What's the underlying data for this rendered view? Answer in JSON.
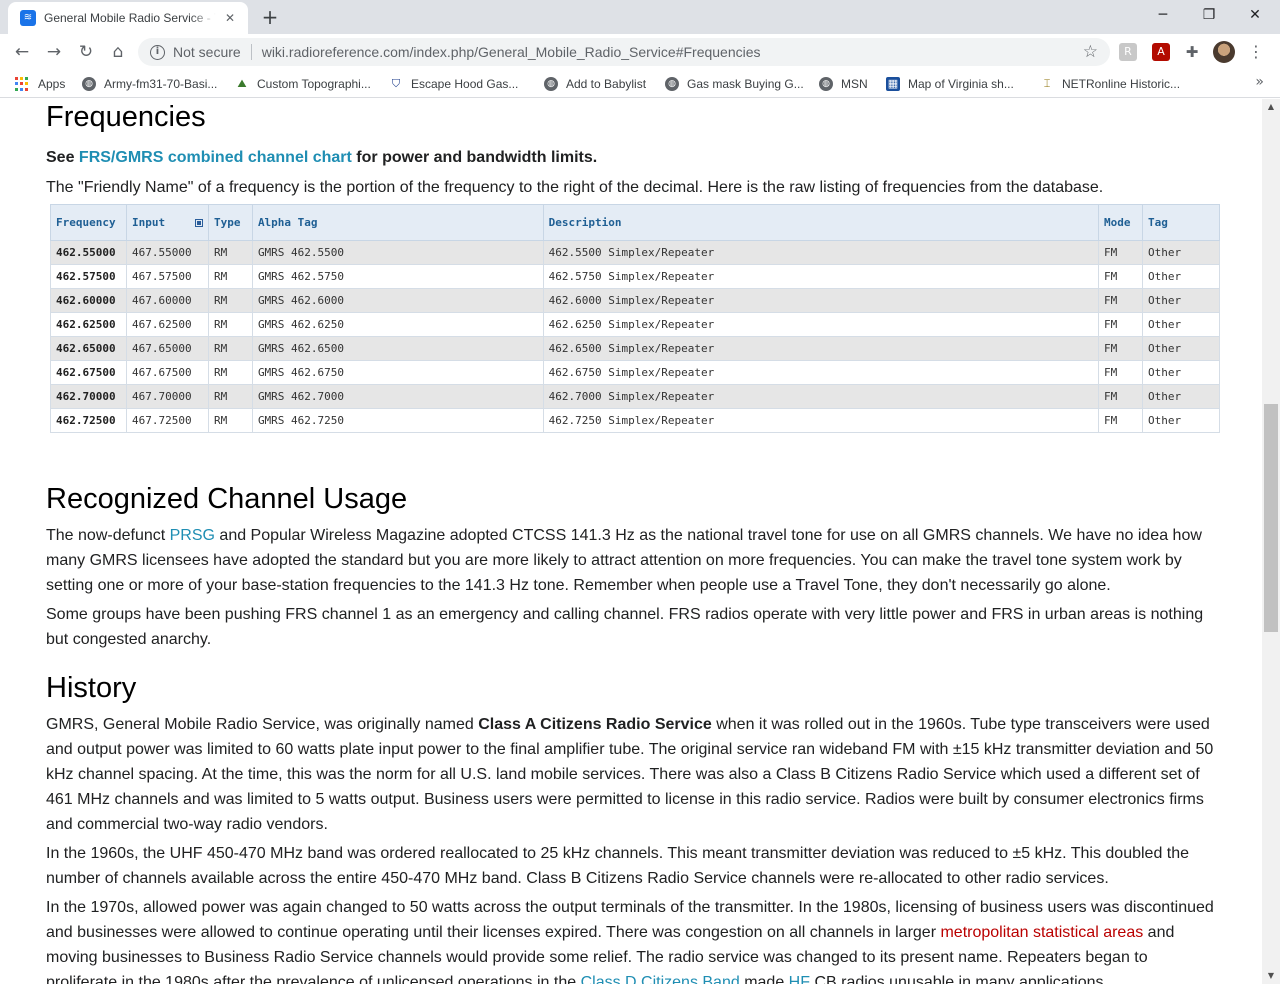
{
  "tab": {
    "title": "General Mobile Radio Service - The RadioReference Wiki",
    "close": "✕",
    "new_tab": "+"
  },
  "window": {
    "minimize": "─",
    "restore": "❐",
    "close": "✕"
  },
  "toolbar": {
    "back": "←",
    "forward": "→",
    "reload": "↻",
    "home": "⌂",
    "not_secure": "Not secure",
    "url": "wiki.radioreference.com/index.php/General_Mobile_Radio_Service#Frequencies",
    "star": "☆",
    "menu": "⋮"
  },
  "bookmarks": {
    "items": [
      {
        "label": "Apps"
      },
      {
        "label": "Army-fm31-70-Basi..."
      },
      {
        "label": "Custom Topographi..."
      },
      {
        "label": "Escape Hood Gas..."
      },
      {
        "label": "Add to Babylist"
      },
      {
        "label": "Gas mask Buying G..."
      },
      {
        "label": "MSN"
      },
      {
        "label": "Map of Virginia  sh..."
      },
      {
        "label": "NETRonline Historic..."
      }
    ],
    "more": "»"
  },
  "frequencies": {
    "heading": "Frequencies",
    "see_prefix": "See ",
    "see_link": "FRS/GMRS combined channel chart",
    "see_suffix": " for power and bandwidth limits.",
    "intro": "The \"Friendly Name\" of a frequency is the portion of the frequency to the right of the decimal. Here is the raw listing of frequencies from the database.",
    "table": {
      "headers": [
        "Frequency",
        "Input",
        "Type",
        "Alpha Tag",
        "Description",
        "Mode",
        "Tag"
      ],
      "rows": [
        [
          "462.55000",
          "467.55000",
          "RM",
          "GMRS 462.5500",
          "462.5500 Simplex/Repeater",
          "FM",
          "Other"
        ],
        [
          "462.57500",
          "467.57500",
          "RM",
          "GMRS 462.5750",
          "462.5750 Simplex/Repeater",
          "FM",
          "Other"
        ],
        [
          "462.60000",
          "467.60000",
          "RM",
          "GMRS 462.6000",
          "462.6000 Simplex/Repeater",
          "FM",
          "Other"
        ],
        [
          "462.62500",
          "467.62500",
          "RM",
          "GMRS 462.6250",
          "462.6250 Simplex/Repeater",
          "FM",
          "Other"
        ],
        [
          "462.65000",
          "467.65000",
          "RM",
          "GMRS 462.6500",
          "462.6500 Simplex/Repeater",
          "FM",
          "Other"
        ],
        [
          "462.67500",
          "467.67500",
          "RM",
          "GMRS 462.6750",
          "462.6750 Simplex/Repeater",
          "FM",
          "Other"
        ],
        [
          "462.70000",
          "467.70000",
          "RM",
          "GMRS 462.7000",
          "462.7000 Simplex/Repeater",
          "FM",
          "Other"
        ],
        [
          "462.72500",
          "467.72500",
          "RM",
          "GMRS 462.7250",
          "462.7250 Simplex/Repeater",
          "FM",
          "Other"
        ]
      ]
    }
  },
  "usage": {
    "heading": "Recognized Channel Usage",
    "p1_a": "The now-defunct ",
    "p1_link": "PRSG",
    "p1_b": " and Popular Wireless Magazine adopted CTCSS 141.3 Hz as the national travel tone for use on all GMRS channels. We have no idea how many GMRS licensees have adopted the standard but you are more likely to attract attention on more frequencies. You can make the travel tone system work by setting one or more of your base-station frequencies to the 141.3 Hz tone. Remember when people use a Travel Tone, they don't necessarily go alone.",
    "p2": "Some groups have been pushing FRS channel 1 as an emergency and calling channel. FRS radios operate with very little power and FRS in urban areas is nothing but congested anarchy."
  },
  "history": {
    "heading": "History",
    "p1_a": "GMRS, General Mobile Radio Service, was originally named ",
    "p1_bold": "Class A Citizens Radio Service",
    "p1_b": " when it was rolled out in the 1960s. Tube type transceivers were used and output power was limited to 60 watts plate input power to the final amplifier tube. The original service ran wideband FM with ±15 kHz transmitter deviation and 50 kHz channel spacing. At the time, this was the norm for all U.S. land mobile services. There was also a Class B Citizens Radio Service which used a different set of 461 MHz channels and was limited to 5 watts output. Business users were permitted to license in this radio service. Radios were built by consumer electronics firms and commercial two-way radio vendors.",
    "p2": "In the 1960s, the UHF 450-470 MHz band was ordered reallocated to 25 kHz channels. This meant transmitter deviation was reduced to ±5 kHz. This doubled the number of channels available across the entire 450-470 MHz band. Class B Citizens Radio Service channels were re-allocated to other radio services.",
    "p3_a": "In the 1970s, allowed power was again changed to 50 watts across the output terminals of the transmitter. In the 1980s, licensing of business users was discontinued and businesses were allowed to continue operating until their licenses expired. There was congestion on all channels in larger ",
    "p3_link": "metropolitan statistical areas",
    "p3_b": " and moving businesses to Business Radio Service channels would provide some relief. The radio service was changed to its present name. Repeaters began to proliferate in the 1980s after the prevalence of unlicensed operations in the ",
    "p3_link2": "Class D Citizens Band",
    "p3_c": " made ",
    "p3_link3": "HF",
    "p3_d": " CB radios unusable in many applications."
  }
}
